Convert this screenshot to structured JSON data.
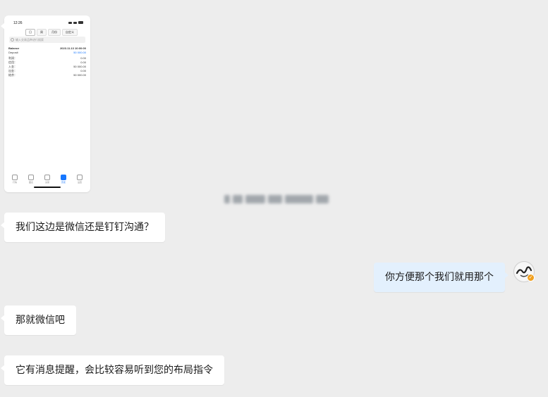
{
  "screenshot_message": {
    "time": "12:26",
    "tabs": [
      "日",
      "周",
      "月份",
      "自定义"
    ],
    "search_placeholder": "输入交易品种进行搜索",
    "header_left": "Balance",
    "header_date": "2023.11.13 10:00:00",
    "rows": [
      {
        "label": "Deposit",
        "value": "50 000.00"
      },
      {
        "label": "利润：",
        "value": "0.00"
      },
      {
        "label": "信用：",
        "value": "0.00"
      },
      {
        "label": "入金：",
        "value": "50 000.00"
      },
      {
        "label": "出金：",
        "value": "0.00"
      },
      {
        "label": "结余：",
        "value": "50 000.00"
      }
    ],
    "nav": [
      "行情",
      "图表",
      "交易",
      "历史",
      "设置"
    ],
    "active_nav": 3
  },
  "messages": [
    {
      "side": "left",
      "text": "我们这边是微信还是钉钉沟通？"
    },
    {
      "side": "right",
      "text": "你方便那个我们就用那个"
    },
    {
      "side": "left",
      "text": "那就微信吧"
    },
    {
      "side": "left",
      "text": "它有消息提醒，会比较容易听到您的布局指令"
    }
  ],
  "avatar": {
    "icon": "user-avatar",
    "badge_icon": "verified-badge-icon",
    "badge_color": "#f0a020"
  },
  "colors": {
    "background": "#ededed",
    "left_bubble": "#ffffff",
    "right_bubble": "#e3f0fd",
    "accent": "#1677ff"
  }
}
